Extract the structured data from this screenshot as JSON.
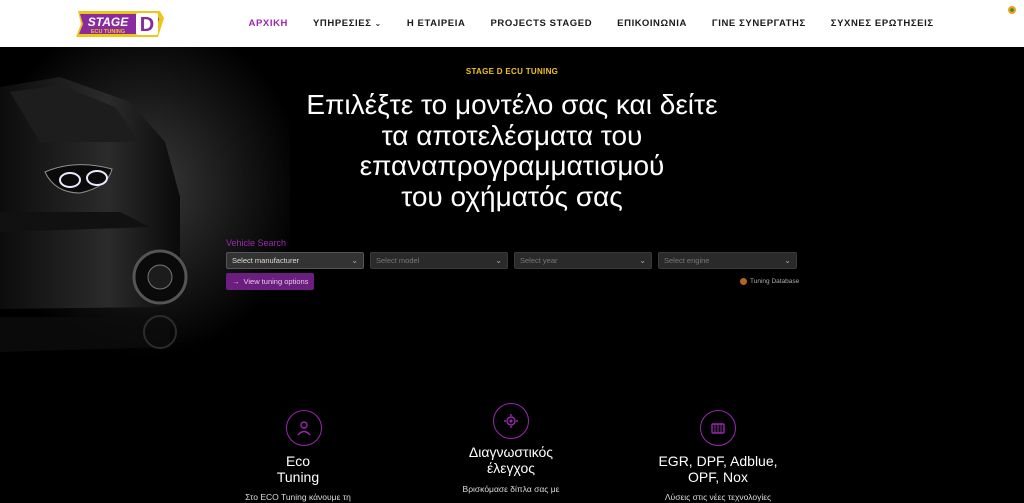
{
  "brand": {
    "logo_text": "STAGE",
    "logo_sub": "ECU TUNING",
    "colors": {
      "accent": "#9b27b0",
      "eyebrow": "#f0c419"
    }
  },
  "nav": {
    "items": [
      {
        "label": "ΑΡΧΙΚΗ",
        "active": true
      },
      {
        "label": "ΥΠΗΡΕΣΙΕΣ",
        "dropdown": true
      },
      {
        "label": "Η ΕΤΑΙΡΕΙΑ"
      },
      {
        "label": "PROJECTS STAGED"
      },
      {
        "label": "ΕΠΙΚΟΙΝΩΝΙΑ"
      },
      {
        "label": "ΓΙΝΕ ΣΥΝΕΡΓΑΤΗΣ"
      },
      {
        "label": "ΣΥΧΝΕΣ ΕΡΩΤΗΣΕΙΣ"
      }
    ]
  },
  "hero": {
    "eyebrow": "STAGE D ECU TUNING",
    "title_lines": [
      "Επιλέξτε το μοντέλο σας και δείτε",
      "τα αποτελέσματα του",
      "επαναπρογραμματισμού",
      "του οχήματός σας"
    ]
  },
  "vehicle_search": {
    "label": "Vehicle Search",
    "manufacturer": "Select manufacturer",
    "model": "Select model",
    "year": "Select year",
    "engine": "Select engine",
    "button": "View tuning options",
    "database_link": "Tuning Database"
  },
  "features": [
    {
      "icon": "gear-person-icon",
      "title_lines": [
        "Eco",
        "Tuning"
      ],
      "text": "Στο ECO Tuning κάνουμε τη"
    },
    {
      "icon": "diagnostic-gear-icon",
      "title_lines": [
        "Διαγνωστικός",
        "έλεγχος"
      ],
      "text": "Βρισκόμασε δίπλα σας με"
    },
    {
      "icon": "filter-icon",
      "title_lines": [
        "EGR, DPF, Adblue,",
        "OPF, Nox"
      ],
      "text": "Λύσεις στις νέες τεχνολογίες"
    }
  ]
}
